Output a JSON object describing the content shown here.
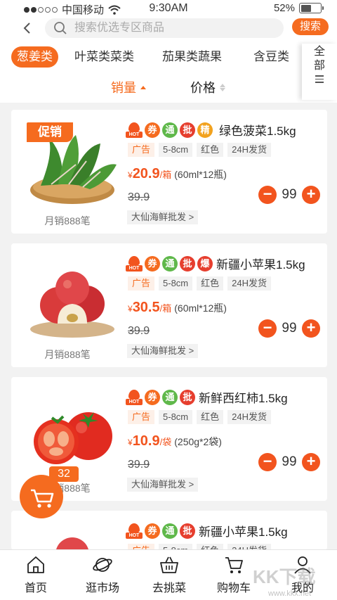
{
  "status": {
    "carrier": "中国移动",
    "time": "9:30AM",
    "battery": "52%",
    "battery_level": 0.52
  },
  "header": {
    "search_placeholder": "搜索优选专区商品",
    "search_button": "搜索"
  },
  "categories": {
    "items": [
      "葱姜类",
      "叶菜类菜类",
      "茄果类蔬果",
      "含豆类"
    ],
    "active_index": 0,
    "all_label": "全部"
  },
  "sort": {
    "sales": "销量",
    "price": "价格"
  },
  "products": [
    {
      "promo": "促销",
      "name": "绿色菠菜1.5kg",
      "badges": [
        "券",
        "通",
        "批",
        "精"
      ],
      "specs": [
        "广告",
        "5-8cm",
        "红色",
        "24H发货"
      ],
      "currency": "¥",
      "price": "20.9",
      "unit": "/箱",
      "pack": "(60ml*12瓶)",
      "original_price": "39.9",
      "seller": "大仙海鲜批发 >",
      "quantity": "99",
      "sales": "月销888笔"
    },
    {
      "name": "新疆小苹果1.5kg",
      "badges": [
        "券",
        "通",
        "批",
        "爆"
      ],
      "specs": [
        "广告",
        "5-8cm",
        "红色",
        "24H发货"
      ],
      "currency": "¥",
      "price": "30.5",
      "unit": "/箱",
      "pack": "(60ml*12瓶)",
      "original_price": "39.9",
      "seller": "大仙海鲜批发 >",
      "quantity": "99",
      "sales": "月销888笔"
    },
    {
      "name": "新鲜西红柿1.5kg",
      "badges": [
        "券",
        "通",
        "批"
      ],
      "specs": [
        "广告",
        "5-8cm",
        "红色",
        "24H发货"
      ],
      "currency": "¥",
      "price": "10.9",
      "unit": "/袋",
      "pack": "(250g*2袋)",
      "original_price": "39.9",
      "seller": "大仙海鲜批发 >",
      "quantity": "99",
      "sales": "月销888笔"
    },
    {
      "name": "新疆小苹果1.5kg",
      "badges": [
        "券",
        "通",
        "批"
      ],
      "specs": [
        "广告",
        "5-8cm",
        "红色",
        "24H发货"
      ]
    }
  ],
  "hot_label": "HOT",
  "minus": "−",
  "plus": "+",
  "floating_cart": {
    "count": "32"
  },
  "nav": {
    "items": [
      "首页",
      "逛市场",
      "去挑菜",
      "购物车",
      "我的"
    ]
  },
  "watermark": {
    "text": "KK下载",
    "sub": "www.kkx.net"
  },
  "colors": {
    "accent": "#f56b1f",
    "price": "#f2541e",
    "green_badge": "#5fb84a",
    "red_badge": "#e63e2e"
  }
}
